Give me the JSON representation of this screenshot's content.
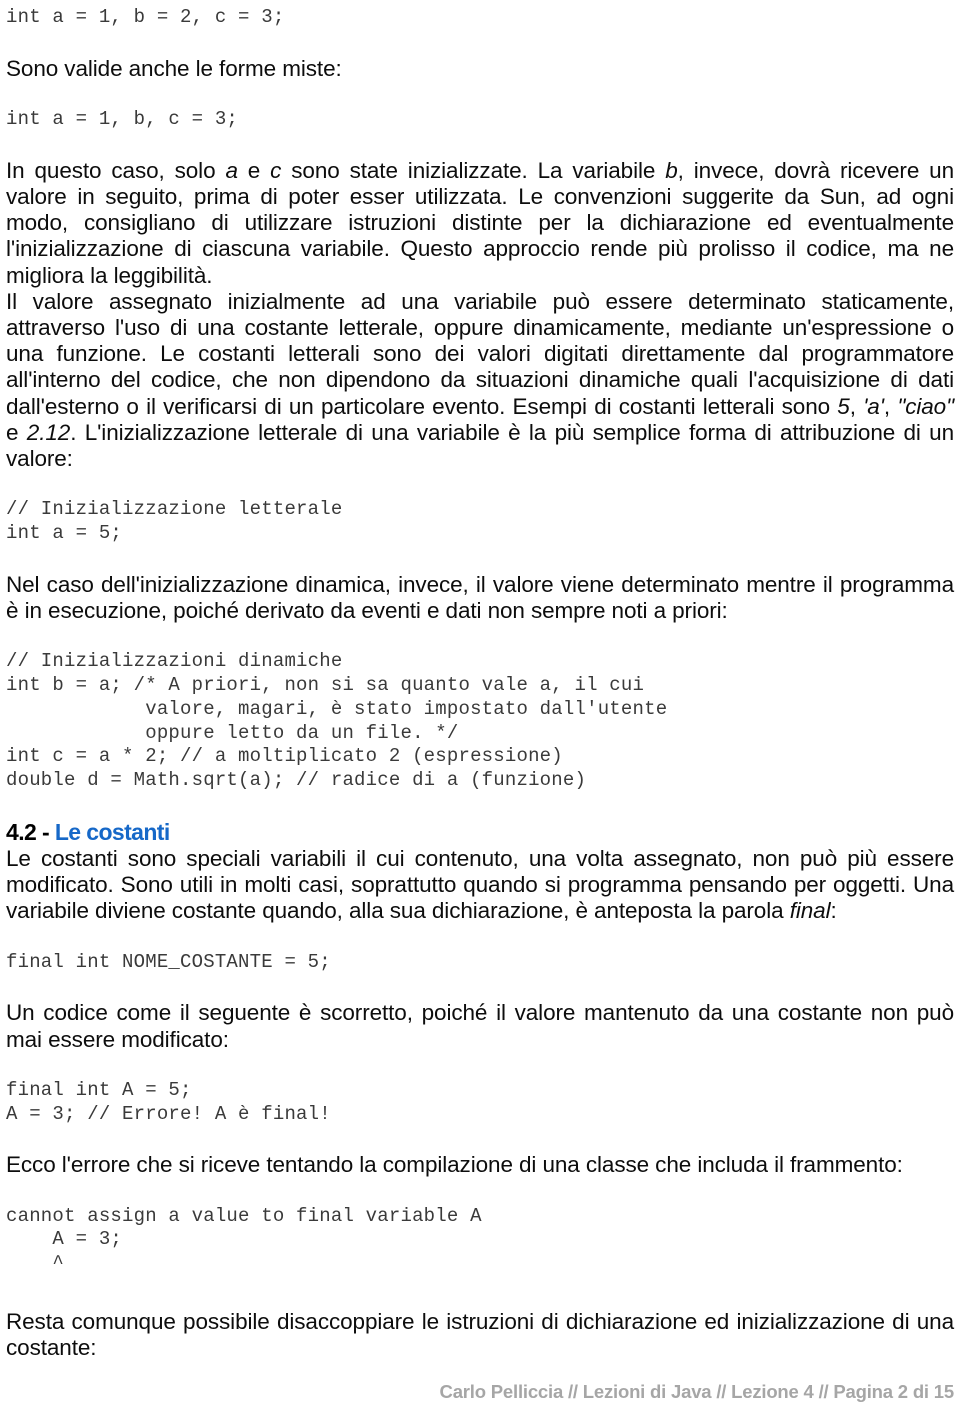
{
  "document": {
    "title": "Lezioni di Java - Lezione 4 - Pagina 2 di 15",
    "colors": {
      "body_text": "#0d0d0d",
      "code_text": "#3a3a3a",
      "heading_number": "#000000",
      "heading_accent": "#1668c8",
      "footer_text": "#a6a6a6",
      "page_background": "#ffffff"
    }
  },
  "blocks": {
    "code_decl_multi": "int a = 1, b = 2, c = 3;",
    "para_forme_miste": "Sono valide anche le forme miste:",
    "code_decl_mixed": "int a = 1, b, c = 3;",
    "para_in_questo_caso": {
      "t1": "In questo caso, solo ",
      "i1": "a",
      "t2": " e ",
      "i2": "c",
      "t3": " sono state inizializzate. La variabile ",
      "i3": "b",
      "t4": ", invece, dovrà ricevere un valore in seguito, prima di poter esser utilizzata. Le convenzioni suggerite da Sun, ad ogni modo, consigliano di utilizzare istruzioni distinte per la dichiarazione ed eventualmente l'inizializzazione di ciascuna variabile. Questo approccio rende più prolisso il codice, ma ne migliora la leggibilità."
    },
    "para_il_valore": {
      "t1": "Il valore assegnato inizialmente ad una variabile può essere determinato staticamente, attraverso l'uso di una costante letterale, oppure dinamicamente, mediante un'espressione o una funzione. Le costanti letterali sono dei valori digitati direttamente dal programmatore all'interno del codice, che non dipendono da situazioni dinamiche quali l'acquisizione di dati dall'esterno o il verificarsi di un particolare evento. Esempi di costanti letterali sono ",
      "i1": "5",
      "t2": ", ",
      "i2": "'a'",
      "t3": ", ",
      "i3": "\"ciao\"",
      "t4": " e ",
      "i4": "2.12",
      "t5": ". L'inizializzazione letterale di una variabile è la più semplice forma di attribuzione di un valore:"
    },
    "code_init_letterale": "// Inizializzazione letterale\nint a = 5;",
    "para_nel_caso": "Nel caso dell'inizializzazione dinamica, invece, il valore viene determinato mentre il programma è in esecuzione, poiché derivato da eventi e dati non sempre noti a priori:",
    "code_init_dinamiche": "// Inizializzazioni dinamiche\nint b = a; /* A priori, non si sa quanto vale a, il cui\n            valore, magari, è stato impostato dall'utente\n            oppure letto da un file. */\nint c = a * 2; // a moltiplicato 2 (espressione)\ndouble d = Math.sqrt(a); // radice di a (funzione)",
    "heading_4_2": {
      "number": "4.2 - ",
      "title": "Le costanti"
    },
    "para_le_costanti": {
      "t1": "Le costanti sono speciali variabili il cui contenuto, una volta assegnato, non può più essere modificato. Sono utili in molti casi, soprattutto quando si programma pensando per oggetti. Una variabile diviene costante quando, alla sua dichiarazione, è anteposta la parola ",
      "i1": "final",
      "t2": ":"
    },
    "code_nome_costante": "final int NOME_COSTANTE = 5;",
    "para_un_codice": "Un codice come il seguente è scorretto, poiché il valore mantenuto da una costante non può mai essere modificato:",
    "code_final_a": "final int A = 5;\nA = 3; // Errore! A è final!",
    "para_ecco_errore": "Ecco l'errore che si riceve tentando la compilazione di una classe che includa il frammento:",
    "code_compile_error": "cannot assign a value to final variable A\n    A = 3;\n    ^",
    "para_resta": "Resta comunque possibile disaccoppiare le istruzioni di dichiarazione ed inizializzazione di una costante:"
  },
  "footer": {
    "text": "Carlo Pelliccia // Lezioni di Java // Lezione 4 // Pagina 2 di 15"
  }
}
